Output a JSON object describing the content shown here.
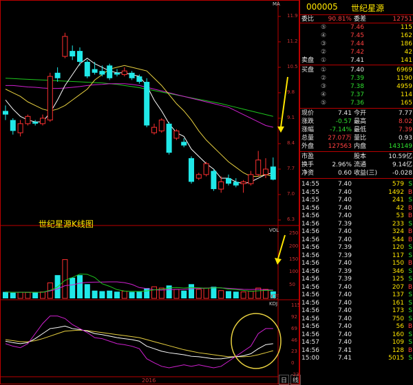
{
  "quote": {
    "code": "000005",
    "name": "世纪星源",
    "weibi_label": "委比",
    "weibi_value": "90.81%",
    "weicha_label": "委差",
    "weicha_value": "12751",
    "sell_label": "卖盘",
    "buy_label": "买盘",
    "sells": [
      {
        "level": "⑤",
        "price": "7.46",
        "vol": "115"
      },
      {
        "level": "④",
        "price": "7.45",
        "vol": "162"
      },
      {
        "level": "③",
        "price": "7.44",
        "vol": "186"
      },
      {
        "level": "②",
        "price": "7.42",
        "vol": "42"
      },
      {
        "level": "①",
        "price": "7.41",
        "vol": "141"
      }
    ],
    "buys": [
      {
        "level": "①",
        "price": "7.40",
        "vol": "6969"
      },
      {
        "level": "②",
        "price": "7.39",
        "vol": "1190"
      },
      {
        "level": "③",
        "price": "7.38",
        "vol": "4959"
      },
      {
        "level": "④",
        "price": "7.37",
        "vol": "114"
      },
      {
        "level": "⑤",
        "price": "7.36",
        "vol": "165"
      }
    ],
    "stats": [
      {
        "l1": "现价",
        "v1": "7.41",
        "l2": "今开",
        "v2": "7.77"
      },
      {
        "l1": "涨跌",
        "v1": "-0.57",
        "l2": "最高",
        "v2": "8.02"
      },
      {
        "l1": "涨幅",
        "v1": "-7.14%",
        "l2": "最低",
        "v2": "7.39"
      },
      {
        "l1": "总量",
        "v1": "27.07万",
        "l2": "量比",
        "v2": "0.93"
      },
      {
        "l1": "外盘",
        "v1": "127563",
        "l2": "内盘",
        "v2": "143149"
      }
    ],
    "stats2": [
      {
        "l1": "市盈",
        "v1": "",
        "l2": "股本",
        "v2": "10.59亿"
      },
      {
        "l1": "换手",
        "v1": "2.96%",
        "l2": "流通",
        "v2": "9.14亿"
      },
      {
        "l1": "净资",
        "v1": "0.60",
        "l2": "收益(三)",
        "v2": "-0.028"
      }
    ],
    "ticks": [
      {
        "t": "14:55",
        "p": "7.40",
        "v": "579",
        "d": "S"
      },
      {
        "t": "14:55",
        "p": "7.40",
        "v": "1492",
        "d": "B"
      },
      {
        "t": "14:55",
        "p": "7.40",
        "v": "241",
        "d": "S"
      },
      {
        "t": "14:56",
        "p": "7.40",
        "v": "42",
        "d": "B"
      },
      {
        "t": "14:56",
        "p": "7.40",
        "v": "53",
        "d": "B"
      },
      {
        "t": "14:56",
        "p": "7.39",
        "v": "233",
        "d": "S"
      },
      {
        "t": "14:56",
        "p": "7.40",
        "v": "324",
        "d": "B"
      },
      {
        "t": "14:56",
        "p": "7.40",
        "v": "544",
        "d": "B"
      },
      {
        "t": "14:56",
        "p": "7.39",
        "v": "120",
        "d": "S"
      },
      {
        "t": "14:56",
        "p": "7.39",
        "v": "117",
        "d": "S"
      },
      {
        "t": "14:56",
        "p": "7.40",
        "v": "150",
        "d": "B"
      },
      {
        "t": "14:56",
        "p": "7.39",
        "v": "346",
        "d": "S"
      },
      {
        "t": "14:56",
        "p": "7.39",
        "v": "125",
        "d": "S"
      },
      {
        "t": "14:56",
        "p": "7.40",
        "v": "207",
        "d": "B"
      },
      {
        "t": "14:56",
        "p": "7.40",
        "v": "137",
        "d": "S"
      },
      {
        "t": "14:56",
        "p": "7.40",
        "v": "161",
        "d": "S"
      },
      {
        "t": "14:56",
        "p": "7.40",
        "v": "173",
        "d": "S"
      },
      {
        "t": "14:56",
        "p": "7.40",
        "v": "750",
        "d": "S"
      },
      {
        "t": "14:56",
        "p": "7.40",
        "v": "56",
        "d": "B"
      },
      {
        "t": "14:56",
        "p": "7.40",
        "v": "160",
        "d": "S"
      },
      {
        "t": "14:57",
        "p": "7.40",
        "v": "109",
        "d": "S"
      },
      {
        "t": "14:56",
        "p": "7.41",
        "v": "128",
        "d": "B"
      },
      {
        "t": "15:00",
        "p": "7.41",
        "v": "5015",
        "d": "S"
      }
    ]
  },
  "chart": {
    "title": "世纪星源K线图",
    "ma_label": "MA",
    "vol_label": "VOL",
    "kdj_label": "KDJ",
    "vol_unit": "X万",
    "year_label": "2016",
    "price_ticks": [
      "11.9",
      "11.2",
      "10.5",
      "9.8",
      "9.1",
      "8.4",
      "7.7",
      "7.0",
      "6.3"
    ],
    "vol_ticks": [
      "250",
      "200",
      "150",
      "100",
      "50"
    ],
    "kdj_ticks": [
      "115",
      "92",
      "69",
      "46",
      "23",
      "0",
      "-23"
    ],
    "bottom_btns": [
      "日",
      "线"
    ]
  },
  "chart_data": {
    "type": "candlestick",
    "title": "世纪星源K线图",
    "ylim": [
      6.3,
      12.2
    ],
    "candles": [
      {
        "o": 9.3,
        "c": 9.2,
        "h": 9.45,
        "l": 9.05
      },
      {
        "o": 9.05,
        "c": 8.75,
        "h": 9.1,
        "l": 8.65
      },
      {
        "o": 8.7,
        "c": 8.95,
        "h": 9.05,
        "l": 8.6
      },
      {
        "o": 8.95,
        "c": 9.15,
        "h": 9.2,
        "l": 8.9
      },
      {
        "o": 9.0,
        "c": 8.95,
        "h": 9.05,
        "l": 8.9
      },
      {
        "o": 8.95,
        "c": 9.1,
        "h": 9.2,
        "l": 8.9
      },
      {
        "o": 9.05,
        "c": 10.25,
        "h": 10.35,
        "l": 9.0
      },
      {
        "o": 10.35,
        "c": 10.2,
        "h": 10.5,
        "l": 10.1
      },
      {
        "o": 10.8,
        "c": 11.35,
        "h": 11.45,
        "l": 10.75
      },
      {
        "o": 10.95,
        "c": 10.8,
        "h": 11.1,
        "l": 10.7
      },
      {
        "o": 10.95,
        "c": 10.65,
        "h": 11.05,
        "l": 10.55
      },
      {
        "o": 10.65,
        "c": 10.25,
        "h": 10.7,
        "l": 10.2
      },
      {
        "o": 10.45,
        "c": 10.35,
        "h": 10.65,
        "l": 10.3
      },
      {
        "o": 10.4,
        "c": 10.3,
        "h": 10.55,
        "l": 10.25
      },
      {
        "o": 10.55,
        "c": 10.2,
        "h": 10.6,
        "l": 10.15
      },
      {
        "o": 10.35,
        "c": 10.3,
        "h": 10.45,
        "l": 10.25
      },
      {
        "o": 10.3,
        "c": 10.4,
        "h": 10.5,
        "l": 10.25
      },
      {
        "o": 10.35,
        "c": 10.2,
        "h": 10.4,
        "l": 10.15
      },
      {
        "o": 10.25,
        "c": 10.1,
        "h": 10.3,
        "l": 10.05
      },
      {
        "o": 10.1,
        "c": 8.9,
        "h": 10.2,
        "l": 8.85
      },
      {
        "o": 8.7,
        "c": 8.85,
        "h": 8.95,
        "l": 8.65
      },
      {
        "o": 8.75,
        "c": 9.05,
        "h": 9.1,
        "l": 8.7
      },
      {
        "o": 8.95,
        "c": 8.15,
        "h": 9.0,
        "l": 8.1
      },
      {
        "o": 8.55,
        "c": 8.75,
        "h": 8.8,
        "l": 8.5
      },
      {
        "o": 8.45,
        "c": 8.35,
        "h": 8.55,
        "l": 8.3
      },
      {
        "o": 8.0,
        "c": 7.35,
        "h": 8.05,
        "l": 7.3
      },
      {
        "o": 7.45,
        "c": 7.55,
        "h": 7.6,
        "l": 7.4
      },
      {
        "o": 7.55,
        "c": 7.85,
        "h": 7.9,
        "l": 7.5
      },
      {
        "o": 7.65,
        "c": 7.15,
        "h": 7.7,
        "l": 7.1
      },
      {
        "o": 7.15,
        "c": 7.35,
        "h": 7.5,
        "l": 7.05
      },
      {
        "o": 7.45,
        "c": 7.3,
        "h": 7.55,
        "l": 7.25
      },
      {
        "o": 7.35,
        "c": 7.25,
        "h": 7.45,
        "l": 7.2
      },
      {
        "o": 7.3,
        "c": 7.35,
        "h": 7.4,
        "l": 7.05
      },
      {
        "o": 7.3,
        "c": 7.55,
        "h": 7.65,
        "l": 7.25
      },
      {
        "o": 7.55,
        "c": 7.95,
        "h": 8.2,
        "l": 7.5
      },
      {
        "o": 7.55,
        "c": 7.7,
        "h": 8.0,
        "l": 7.45
      },
      {
        "o": 7.77,
        "c": 7.41,
        "h": 8.02,
        "l": 7.39
      }
    ],
    "volume": [
      25,
      22,
      24,
      23,
      24,
      25,
      60,
      90,
      150,
      80,
      90,
      55,
      30,
      28,
      30,
      26,
      28,
      25,
      26,
      40,
      45,
      40,
      50,
      35,
      30,
      55,
      35,
      40,
      45,
      30,
      28,
      26,
      25,
      28,
      40,
      35,
      27
    ],
    "ma5": [
      9.6,
      9.35,
      9.15,
      9.05,
      9.0,
      9.0,
      9.25,
      9.6,
      10.0,
      10.3,
      10.6,
      10.75,
      10.6,
      10.5,
      10.4,
      10.35,
      10.35,
      10.3,
      10.25,
      10.0,
      9.6,
      9.3,
      8.95,
      8.7,
      8.6,
      8.25,
      8.05,
      7.85,
      7.7,
      7.45,
      7.45,
      7.35,
      7.3,
      7.35,
      7.45,
      7.55,
      7.6
    ],
    "ma10": [
      9.9,
      9.8,
      9.7,
      9.55,
      9.45,
      9.35,
      9.3,
      9.35,
      9.45,
      9.6,
      9.75,
      9.9,
      10.15,
      10.3,
      10.45,
      10.5,
      10.55,
      10.5,
      10.45,
      10.4,
      10.2,
      10.0,
      9.75,
      9.5,
      9.3,
      9.05,
      8.75,
      8.5,
      8.3,
      8.1,
      7.9,
      7.75,
      7.6,
      7.5,
      7.5,
      7.55,
      7.5
    ],
    "ma20": [
      10.0,
      10.0,
      9.98,
      9.96,
      9.95,
      9.93,
      9.92,
      9.92,
      9.93,
      9.95,
      9.97,
      10.0,
      10.02,
      10.03,
      10.05,
      10.05,
      10.05,
      10.03,
      10.0,
      9.95,
      9.9,
      9.85,
      9.8,
      9.75,
      9.7,
      9.65,
      9.6,
      9.55,
      9.5,
      9.45,
      9.4,
      9.3,
      9.2,
      9.1,
      9.0,
      8.9,
      8.85
    ],
    "ma60": [
      10.2,
      10.19,
      10.18,
      10.17,
      10.16,
      10.15,
      10.14,
      10.13,
      10.12,
      10.11,
      10.1,
      10.09,
      10.08,
      10.07,
      10.05,
      10.03,
      10.0,
      9.97,
      9.94,
      9.9,
      9.86,
      9.82,
      9.78,
      9.74,
      9.7,
      9.66,
      9.62,
      9.58,
      9.54,
      9.5,
      9.45,
      9.4,
      9.35,
      9.3,
      9.25,
      9.2,
      9.15
    ],
    "kdj_k": [
      45,
      42,
      40,
      42,
      50,
      60,
      70,
      72,
      75,
      70,
      68,
      65,
      60,
      58,
      55,
      52,
      50,
      48,
      45,
      35,
      30,
      25,
      22,
      20,
      18,
      15,
      14,
      12,
      10,
      10,
      12,
      14,
      16,
      20,
      30,
      38,
      40
    ],
    "kdj_d": [
      48,
      46,
      44,
      44,
      46,
      50,
      55,
      60,
      65,
      66,
      67,
      66,
      64,
      62,
      60,
      58,
      56,
      54,
      52,
      48,
      44,
      40,
      36,
      32,
      28,
      25,
      22,
      20,
      18,
      16,
      14,
      14,
      14,
      15,
      18,
      22,
      26
    ],
    "kdj_j": [
      40,
      35,
      32,
      40,
      60,
      80,
      95,
      95,
      90,
      78,
      70,
      62,
      52,
      50,
      45,
      40,
      38,
      35,
      30,
      10,
      2,
      -5,
      -8,
      -5,
      -2,
      -5,
      -2,
      -5,
      -8,
      -5,
      5,
      15,
      25,
      35,
      60,
      70,
      70
    ]
  }
}
